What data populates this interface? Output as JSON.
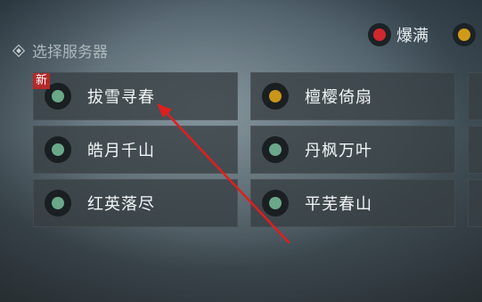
{
  "header": {
    "title": "选择服务器"
  },
  "legend": [
    {
      "label": "爆满",
      "color": "#d0282c"
    },
    {
      "label": "",
      "color": "#d09a18"
    }
  ],
  "status_colors": {
    "green": "#6aa889",
    "yellow": "#c9961a",
    "red": "#d0282c"
  },
  "badge": {
    "new_label": "新"
  },
  "servers": [
    {
      "name": "拔雪寻春",
      "status": "green"
    },
    {
      "name": "檀樱倚扇",
      "status": "yellow"
    },
    {
      "name": "皓月千山",
      "status": "green"
    },
    {
      "name": "丹枫万叶",
      "status": "green"
    },
    {
      "name": "红英落尽",
      "status": "green"
    },
    {
      "name": "平芜春山",
      "status": "green"
    }
  ]
}
